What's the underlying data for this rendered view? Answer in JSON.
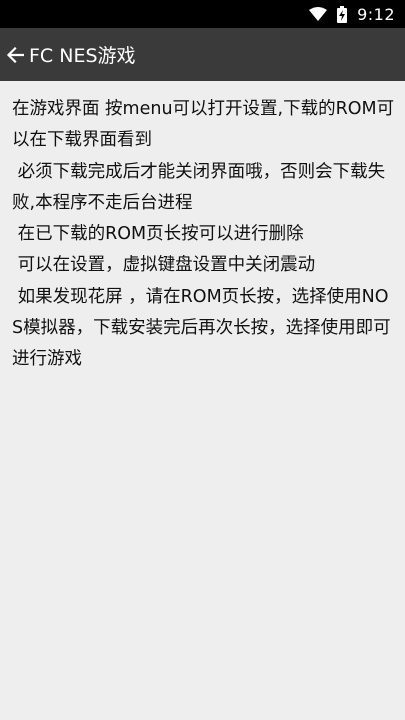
{
  "status_bar": {
    "time": "9:12",
    "icons": [
      "wifi-icon",
      "battery-charging-icon"
    ]
  },
  "app_bar": {
    "title": "FC NES游戏",
    "back_icon": "arrow-left-icon"
  },
  "content": {
    "lines": [
      "在游戏界面 按menu可以打开设置,下载的ROM可以在下载界面看到",
      " 必须下载完成后才能关闭界面哦，否则会下载失败,本程序不走后台进程",
      " 在已下载的ROM页长按可以进行删除",
      " 可以在设置，虚拟键盘设置中关闭震动",
      " 如果发现花屏 ，请在ROM页长按，选择使用NOS模拟器，下载安装完后再次长按，选择使用即可进行游戏"
    ]
  }
}
